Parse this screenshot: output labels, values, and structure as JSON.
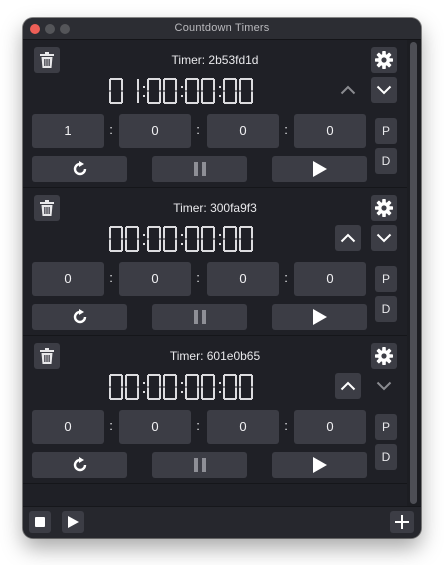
{
  "window": {
    "title": "Countdown Timers"
  },
  "timers": [
    {
      "title": "Timer: 2b53fd1d",
      "display": "01:00:00:00",
      "fields": [
        "1",
        "0",
        "0",
        "0"
      ],
      "p_label": "P",
      "d_label": "D",
      "up_enabled": false,
      "down_enabled": true
    },
    {
      "title": "Timer: 300fa9f3",
      "display": "00:00:00:00",
      "fields": [
        "0",
        "0",
        "0",
        "0"
      ],
      "p_label": "P",
      "d_label": "D",
      "up_enabled": true,
      "down_enabled": true
    },
    {
      "title": "Timer: 601e0b65",
      "display": "00:00:00:00",
      "fields": [
        "0",
        "0",
        "0",
        "0"
      ],
      "p_label": "P",
      "d_label": "D",
      "up_enabled": true,
      "down_enabled": false
    }
  ],
  "separator": ":",
  "icons": {
    "trash": "trash-icon",
    "gear": "gear-icon",
    "up": "chevron-up-icon",
    "down": "chevron-down-icon",
    "reset": "reset-icon",
    "pause": "pause-icon",
    "play": "play-icon",
    "stop": "stop-icon",
    "add": "plus-icon"
  },
  "colors": {
    "background": "#1f2026",
    "button": "#3c3d45",
    "text": "#e9e9ec",
    "segment_on": "#dcdcdf",
    "close": "#ee5f57"
  }
}
